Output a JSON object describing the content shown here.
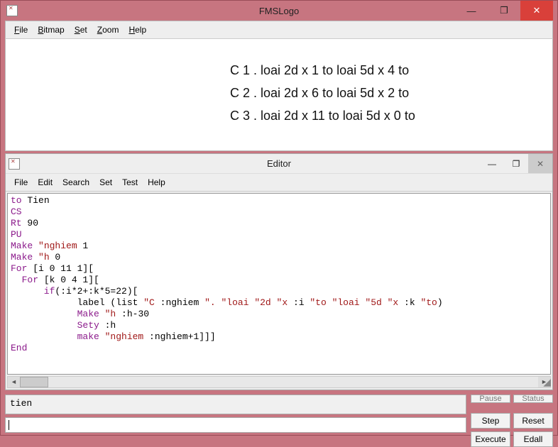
{
  "main_window": {
    "title": "FMSLogo",
    "menu": {
      "file": "File",
      "bitmap": "Bitmap",
      "set": "Set",
      "zoom": "Zoom",
      "help": "Help"
    },
    "win_controls": {
      "min": "—",
      "max": "❐",
      "close": "✕"
    }
  },
  "canvas_lines": [
    "C 1 . loai 2d x 1 to loai 5d x 4 to",
    "C 2 . loai 2d x 6 to loai 5d x 2 to",
    "C 3 . loai 2d x 11 to loai 5d x 0 to"
  ],
  "editor_window": {
    "title": "Editor",
    "menu": {
      "file": "File",
      "edit": "Edit",
      "search": "Search",
      "set": "Set",
      "test": "Test",
      "help": "Help"
    },
    "win_controls": {
      "min": "—",
      "max": "❐",
      "close": "✕"
    },
    "scroll": {
      "left": "◄",
      "right": "►"
    }
  },
  "code": {
    "l1a": "to",
    "l1b": " Tien",
    "l2": "CS",
    "l3a": "Rt",
    "l3b": " 90",
    "l4": "PU",
    "l5a": "Make ",
    "l5b": "\"nghiem",
    "l5c": " 1",
    "l6a": "Make ",
    "l6b": "\"h",
    "l6c": " 0",
    "l7a": "For",
    "l7b": " [i 0 11 1][",
    "l8a": "  For",
    "l8b": " [k 0 4 1][",
    "l9a": "      if",
    "l9b": "(:i*2+:k*5=22)[",
    "l10a": "            label (list ",
    "l10b": "\"C",
    "l10c": " :nghiem ",
    "l10d": "\".",
    "l10e": " ",
    "l10f": "\"loai",
    "l10g": " ",
    "l10h": "\"2d",
    "l10i": " ",
    "l10j": "\"x",
    "l10k": " :i ",
    "l10l": "\"to",
    "l10m": " ",
    "l10n": "\"loai",
    "l10o": " ",
    "l10p": "\"5d",
    "l10q": " ",
    "l10r": "\"x",
    "l10s": " :k ",
    "l10t": "\"to",
    "l10u": ")",
    "l11a": "            Make ",
    "l11b": "\"h",
    "l11c": " :h-30",
    "l12a": "            Sety",
    "l12b": " :h",
    "l13a": "            make ",
    "l13b": "\"nghiem",
    "l13c": " :nghiem+1]]]",
    "l14": "End"
  },
  "commander": {
    "history": "tien",
    "input": "",
    "buttons": {
      "pause_half": "Pause",
      "status_half": "Status",
      "step": "Step",
      "reset": "Reset",
      "execute": "Execute",
      "edall": "Edall"
    }
  }
}
